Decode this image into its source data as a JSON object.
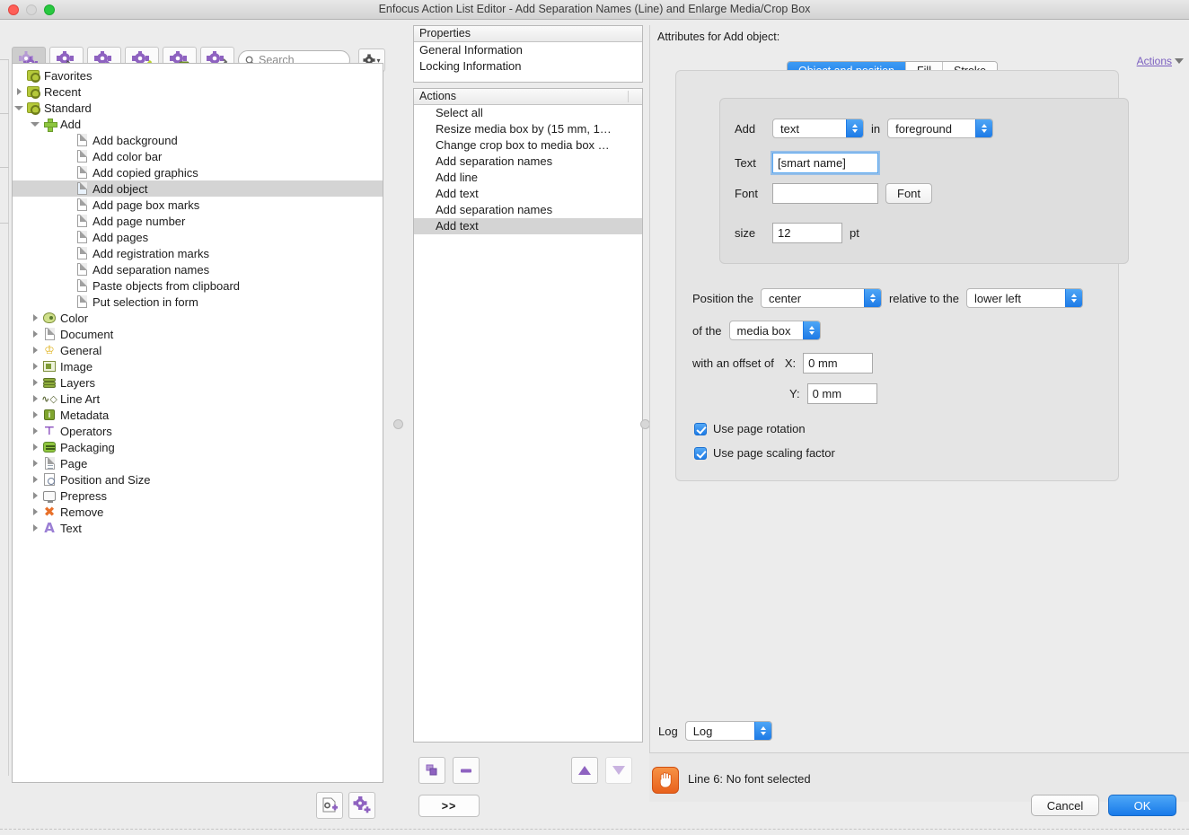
{
  "window": {
    "title": "Enfocus Action List Editor - Add Separation Names (Line) and Enlarge Media/Crop Box",
    "traffic_lights": [
      "close",
      "minimize",
      "zoom"
    ]
  },
  "toolbar": {
    "buttons": [
      {
        "name": "action-lists-icon",
        "label": "Action Lists",
        "active": true
      },
      {
        "name": "gear-pointer-icon",
        "label": "Select Action",
        "active": false
      },
      {
        "name": "gear-refresh-icon",
        "label": "Update Action",
        "active": false
      },
      {
        "name": "gear-check-icon",
        "label": "Validate Action",
        "active": false
      },
      {
        "name": "gear-info-icon",
        "label": "Action Info",
        "active": false
      },
      {
        "name": "gear-wrench-icon",
        "label": "Configure Action",
        "active": false
      }
    ],
    "search": {
      "placeholder": "Search",
      "value": "",
      "icon": "search-icon"
    },
    "gear_menu": {
      "icon": "gear-icon",
      "caret": "▾"
    }
  },
  "tree": {
    "items": [
      {
        "label": "Favorites",
        "depth": 1,
        "icon": "folder-gear-icon",
        "twisty": "none",
        "selected": false
      },
      {
        "label": "Recent",
        "depth": 1,
        "icon": "folder-gear-icon",
        "twisty": "collapsed",
        "selected": false
      },
      {
        "label": "Standard",
        "depth": 1,
        "icon": "folder-gear-icon",
        "twisty": "expanded",
        "selected": false
      },
      {
        "label": "Add",
        "depth": 2,
        "icon": "plus-icon",
        "twisty": "expanded",
        "selected": false
      },
      {
        "label": "Add background",
        "depth": 4,
        "icon": "page-icon",
        "twisty": "none",
        "selected": false
      },
      {
        "label": "Add color bar",
        "depth": 4,
        "icon": "page-icon",
        "twisty": "none",
        "selected": false
      },
      {
        "label": "Add copied graphics",
        "depth": 4,
        "icon": "page-icon",
        "twisty": "none",
        "selected": false
      },
      {
        "label": "Add object",
        "depth": 4,
        "icon": "page-icon-selected",
        "twisty": "none",
        "selected": true
      },
      {
        "label": "Add page box marks",
        "depth": 4,
        "icon": "page-icon",
        "twisty": "none",
        "selected": false
      },
      {
        "label": "Add page number",
        "depth": 4,
        "icon": "page-icon",
        "twisty": "none",
        "selected": false
      },
      {
        "label": "Add pages",
        "depth": 4,
        "icon": "page-icon",
        "twisty": "none",
        "selected": false
      },
      {
        "label": "Add registration marks",
        "depth": 4,
        "icon": "page-icon",
        "twisty": "none",
        "selected": false
      },
      {
        "label": "Add separation names",
        "depth": 4,
        "icon": "page-icon",
        "twisty": "none",
        "selected": false
      },
      {
        "label": "Paste objects from clipboard",
        "depth": 4,
        "icon": "page-icon",
        "twisty": "none",
        "selected": false
      },
      {
        "label": "Put selection in form",
        "depth": 4,
        "icon": "page-icon",
        "twisty": "none",
        "selected": false
      },
      {
        "label": "Color",
        "depth": 2,
        "icon": "palette-icon",
        "twisty": "collapsed",
        "selected": false
      },
      {
        "label": "Document",
        "depth": 2,
        "icon": "document-icon",
        "twisty": "collapsed",
        "selected": false
      },
      {
        "label": "General",
        "depth": 2,
        "icon": "crown-icon",
        "twisty": "collapsed",
        "selected": false
      },
      {
        "label": "Image",
        "depth": 2,
        "icon": "image-icon",
        "twisty": "collapsed",
        "selected": false
      },
      {
        "label": "Layers",
        "depth": 2,
        "icon": "layers-icon",
        "twisty": "collapsed",
        "selected": false
      },
      {
        "label": "Line Art",
        "depth": 2,
        "icon": "line-art-icon",
        "twisty": "collapsed",
        "selected": false
      },
      {
        "label": "Metadata",
        "depth": 2,
        "icon": "metadata-icon",
        "twisty": "collapsed",
        "selected": false
      },
      {
        "label": "Operators",
        "depth": 2,
        "icon": "operators-icon",
        "twisty": "collapsed",
        "selected": false
      },
      {
        "label": "Packaging",
        "depth": 2,
        "icon": "packaging-icon",
        "twisty": "collapsed",
        "selected": false
      },
      {
        "label": "Page",
        "depth": 2,
        "icon": "page-lines-icon",
        "twisty": "collapsed",
        "selected": false
      },
      {
        "label": "Position and Size",
        "depth": 2,
        "icon": "position-size-icon",
        "twisty": "collapsed",
        "selected": false
      },
      {
        "label": "Prepress",
        "depth": 2,
        "icon": "prepress-icon",
        "twisty": "collapsed",
        "selected": false
      },
      {
        "label": "Remove",
        "depth": 2,
        "icon": "remove-icon",
        "twisty": "collapsed",
        "selected": false
      },
      {
        "label": "Text",
        "depth": 2,
        "icon": "text-icon",
        "twisty": "collapsed",
        "selected": false
      }
    ],
    "bottom_buttons": [
      {
        "name": "new-action-list-button",
        "icon": "page-plus-icon"
      },
      {
        "name": "new-action-button",
        "icon": "gear-plus-icon"
      }
    ]
  },
  "properties": {
    "header": "Properties",
    "rows": [
      "General Information",
      "Locking Information"
    ]
  },
  "actions_list": {
    "header": "Actions",
    "rows": [
      {
        "label": "Select all",
        "selected": false
      },
      {
        "label": "Resize media box by (15 mm, 1…",
        "selected": false
      },
      {
        "label": "Change crop box to media box …",
        "selected": false
      },
      {
        "label": "Add separation names",
        "selected": false
      },
      {
        "label": "Add line",
        "selected": false
      },
      {
        "label": "Add text",
        "selected": false
      },
      {
        "label": "Add separation names",
        "selected": false
      },
      {
        "label": "Add text",
        "selected": true
      }
    ],
    "buttons": [
      {
        "name": "duplicate-action-button",
        "icon": "duplicate-icon",
        "enabled": true
      },
      {
        "name": "remove-action-button",
        "icon": "minus-icon",
        "enabled": true
      },
      {
        "name": "move-up-button",
        "icon": "triangle-up-icon",
        "enabled": true
      },
      {
        "name": "move-down-button",
        "icon": "triangle-down-icon",
        "enabled": false
      }
    ],
    "expand_button": ">>"
  },
  "attributes": {
    "header": "Attributes for Add object:",
    "actions_link": {
      "label": "Actions",
      "caret": "▾"
    },
    "tabs": [
      {
        "label": "Object and position",
        "active": true
      },
      {
        "label": "Fill",
        "active": false
      },
      {
        "label": "Stroke",
        "active": false
      }
    ],
    "object": {
      "add_label": "Add",
      "add_value": "text",
      "in_label": "in",
      "in_value": "foreground",
      "text_label": "Text",
      "text_value": "[smart name]",
      "font_label": "Font",
      "font_value": "",
      "font_button": "Font",
      "size_label": "size",
      "size_value": "12",
      "size_unit": "pt"
    },
    "position": {
      "position_label": "Position the",
      "position_value": "center",
      "relative_label": "relative to the",
      "relative_value": "lower left",
      "of_the_label": "of the",
      "of_the_value": "media box",
      "offset_label": "with an offset of",
      "x_label": "X:",
      "x_value": "0 mm",
      "y_label": "Y:",
      "y_value": "0 mm",
      "checkboxes": [
        {
          "label": "Use page rotation",
          "checked": true
        },
        {
          "label": "Use page scaling factor",
          "checked": true
        }
      ]
    },
    "log": {
      "label": "Log",
      "value": "Log"
    }
  },
  "status": {
    "icon": "stop-hand-icon",
    "message": "Line 6: No font selected"
  },
  "dialog_buttons": [
    {
      "label": "Cancel",
      "primary": false
    },
    {
      "label": "OK",
      "primary": true
    }
  ],
  "colors": {
    "accent_blue": "#1f7ce8",
    "selection_gray": "#d4d4d4",
    "warning_orange": "#e8611c",
    "link_purple": "#7b5fc0",
    "panel_bg": "#ececec"
  }
}
